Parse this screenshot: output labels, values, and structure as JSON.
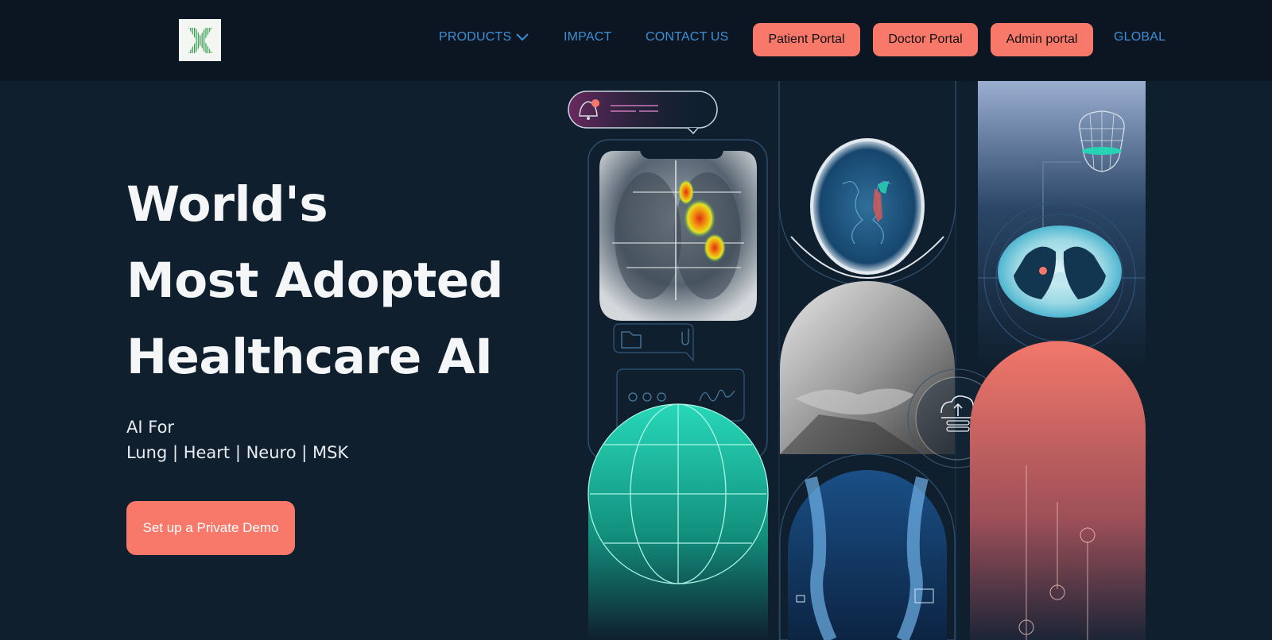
{
  "nav": {
    "products_label": "PRODUCTS",
    "impact_label": "IMPACT",
    "contact_label": "CONTACT US",
    "patient_portal_label": "Patient Portal",
    "doctor_portal_label": "Doctor Portal",
    "admin_portal_label": "Admin portal",
    "global_label": "GLOBAL"
  },
  "hero": {
    "title_lines": [
      "World's",
      "Most Adopted",
      "Healthcare AI"
    ],
    "subtitle_line1": "AI For",
    "subtitle_line2": "Lung | Heart | Neuro | MSK",
    "cta_label": "Set up a Private Demo"
  },
  "colors": {
    "background": "#0f1f2e",
    "navbar": "#0b1622",
    "accent_coral": "#f8786a",
    "nav_link_blue": "#3d8fd6",
    "teal": "#27d3b3"
  },
  "icons": [
    "logo-x-icon",
    "chevron-down-icon",
    "bell-icon",
    "folder-icon",
    "paperclip-icon",
    "cloud-upload-icon"
  ]
}
